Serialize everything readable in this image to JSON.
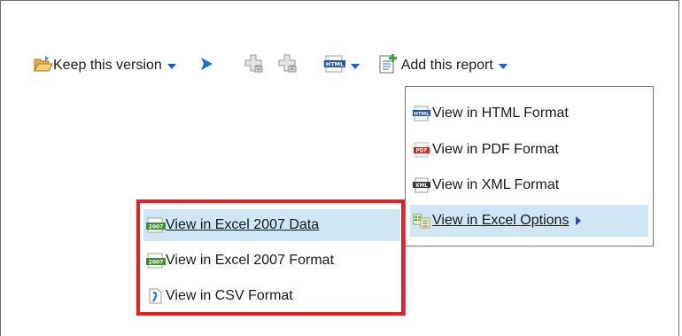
{
  "toolbar": {
    "keep_version_label": "Keep this version",
    "add_report_label": "Add this report",
    "icons": [
      "folder-open-icon",
      "play-icon",
      "add-field-icon",
      "remove-field-icon",
      "html-format-icon",
      "add-report-icon"
    ]
  },
  "view_menu": {
    "items": [
      {
        "label": "View in HTML Format",
        "icon": "html-file-icon"
      },
      {
        "label": "View in PDF Format",
        "icon": "pdf-file-icon"
      },
      {
        "label": "View in XML Format",
        "icon": "xml-file-icon"
      },
      {
        "label": "View in Excel Options",
        "icon": "excel-options-icon",
        "selected": true,
        "has_submenu": true
      }
    ]
  },
  "excel_submenu": {
    "items": [
      {
        "label": "View in Excel 2007 Data",
        "icon": "excel-2007-icon",
        "selected": true
      },
      {
        "label": "View in Excel 2007 Format",
        "icon": "excel-2007-icon"
      },
      {
        "label": "View in CSV Format",
        "icon": "csv-file-icon"
      }
    ]
  },
  "colors": {
    "accent_blue": "#1d5fc2",
    "selection": "#cfe7f4",
    "highlight_red": "#e02127"
  }
}
